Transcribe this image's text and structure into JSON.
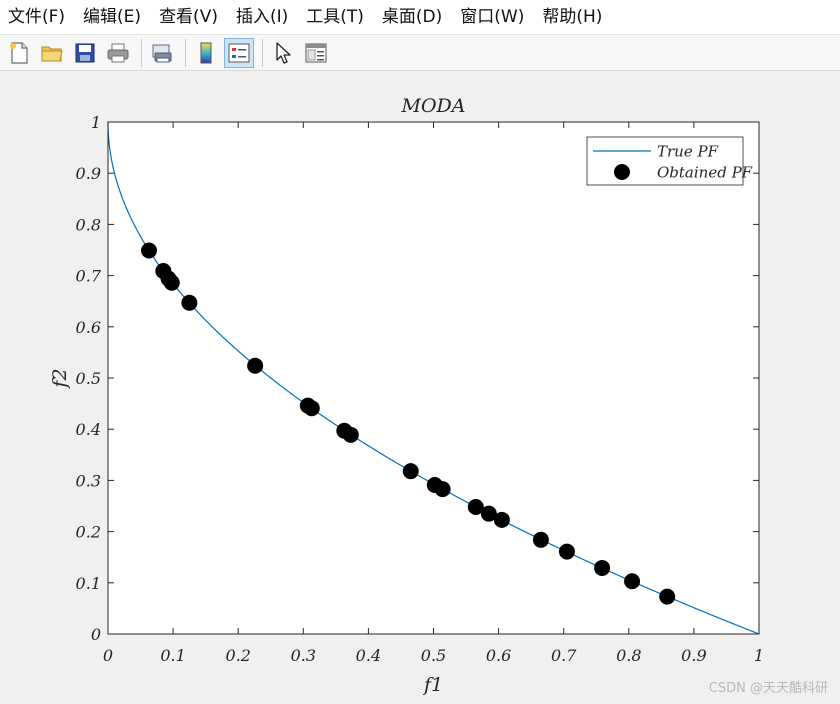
{
  "menubar": {
    "items": [
      "文件(F)",
      "编辑(E)",
      "查看(V)",
      "插入(I)",
      "工具(T)",
      "桌面(D)",
      "窗口(W)",
      "帮助(H)"
    ]
  },
  "toolbar": {
    "buttons": [
      "new-file-icon",
      "open-folder-icon",
      "save-icon",
      "print-icon",
      "print-preview-icon",
      "colorbar-icon",
      "legend-icon",
      "pointer-icon",
      "property-editor-icon"
    ]
  },
  "watermark": "CSDN @天天酷科研",
  "chart_data": {
    "type": "scatter",
    "title": "MODA",
    "xlabel": "f1",
    "ylabel": "f2",
    "xlim": [
      0,
      1
    ],
    "ylim": [
      0,
      1
    ],
    "xticks": [
      "0",
      "0.1",
      "0.2",
      "0.3",
      "0.4",
      "0.5",
      "0.6",
      "0.7",
      "0.8",
      "0.9",
      "1"
    ],
    "yticks": [
      "0",
      "0.1",
      "0.2",
      "0.3",
      "0.4",
      "0.5",
      "0.6",
      "0.7",
      "0.8",
      "0.9",
      "1"
    ],
    "legend_position": "top-right",
    "grid": false,
    "series": [
      {
        "name": "True PF",
        "kind": "line",
        "function": "f2 = 1 - sqrt(f1)",
        "color": "#0072BD"
      },
      {
        "name": "Obtained PF",
        "kind": "scatter",
        "color": "#000000",
        "points": [
          [
            0.063,
            0.749
          ],
          [
            0.085,
            0.709
          ],
          [
            0.093,
            0.694
          ],
          [
            0.098,
            0.686
          ],
          [
            0.125,
            0.647
          ],
          [
            0.226,
            0.524
          ],
          [
            0.307,
            0.446
          ],
          [
            0.313,
            0.441
          ],
          [
            0.363,
            0.397
          ],
          [
            0.373,
            0.389
          ],
          [
            0.465,
            0.318
          ],
          [
            0.502,
            0.291
          ],
          [
            0.514,
            0.283
          ],
          [
            0.565,
            0.248
          ],
          [
            0.585,
            0.235
          ],
          [
            0.605,
            0.223
          ],
          [
            0.665,
            0.184
          ],
          [
            0.705,
            0.161
          ],
          [
            0.759,
            0.129
          ],
          [
            0.805,
            0.103
          ],
          [
            0.859,
            0.073
          ]
        ]
      }
    ]
  }
}
